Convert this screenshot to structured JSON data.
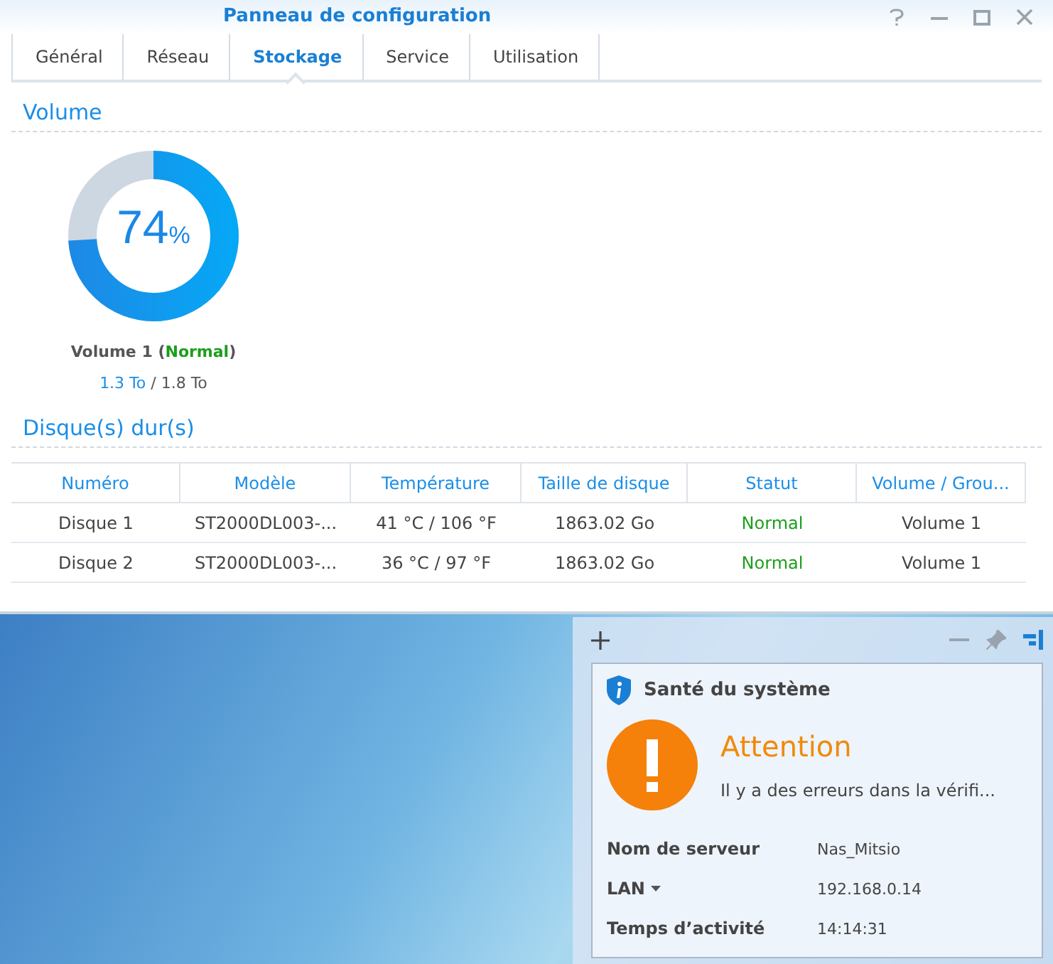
{
  "window": {
    "title": "Panneau de configuration"
  },
  "tabs": [
    {
      "label": "Général",
      "selected": false
    },
    {
      "label": "Réseau",
      "selected": false
    },
    {
      "label": "Stockage",
      "selected": true
    },
    {
      "label": "Service",
      "selected": false
    },
    {
      "label": "Utilisation",
      "selected": false
    }
  ],
  "volume_section": {
    "title": "Volume",
    "volume": {
      "percent": "74",
      "unit": "%",
      "level": 0.74,
      "caption_prefix": "Volume 1 (",
      "status": "Normal",
      "caption_suffix": ")",
      "used": "1.3 To",
      "rest": " / 1.8 To"
    }
  },
  "disks_section": {
    "title": "Disque(s) dur(s)",
    "columns": [
      "Numéro",
      "Modèle",
      "Température",
      "Taille de disque",
      "Statut",
      "Volume / Grou..."
    ],
    "rows": [
      [
        "Disque 1",
        "ST2000DL003-...",
        "41 °C / 106 °F",
        "1863.02 Go",
        "Normal",
        "Volume 1"
      ],
      [
        "Disque 2",
        "ST2000DL003-...",
        "36 °C / 97 °F",
        "1863.02 Go",
        "Normal",
        "Volume 1"
      ]
    ]
  },
  "widget": {
    "title": "Santé du système",
    "status": "Attention",
    "message": "Il y a des erreurs dans la vérifi...",
    "info": [
      {
        "label": "Nom de serveur",
        "value": "Nas_Mitsio",
        "kind": "plain"
      },
      {
        "label": "LAN",
        "value": "192.168.0.14",
        "kind": "dropdown"
      },
      {
        "label": "Temps d’activité",
        "value": "14:14:31",
        "kind": "plain"
      }
    ]
  }
}
